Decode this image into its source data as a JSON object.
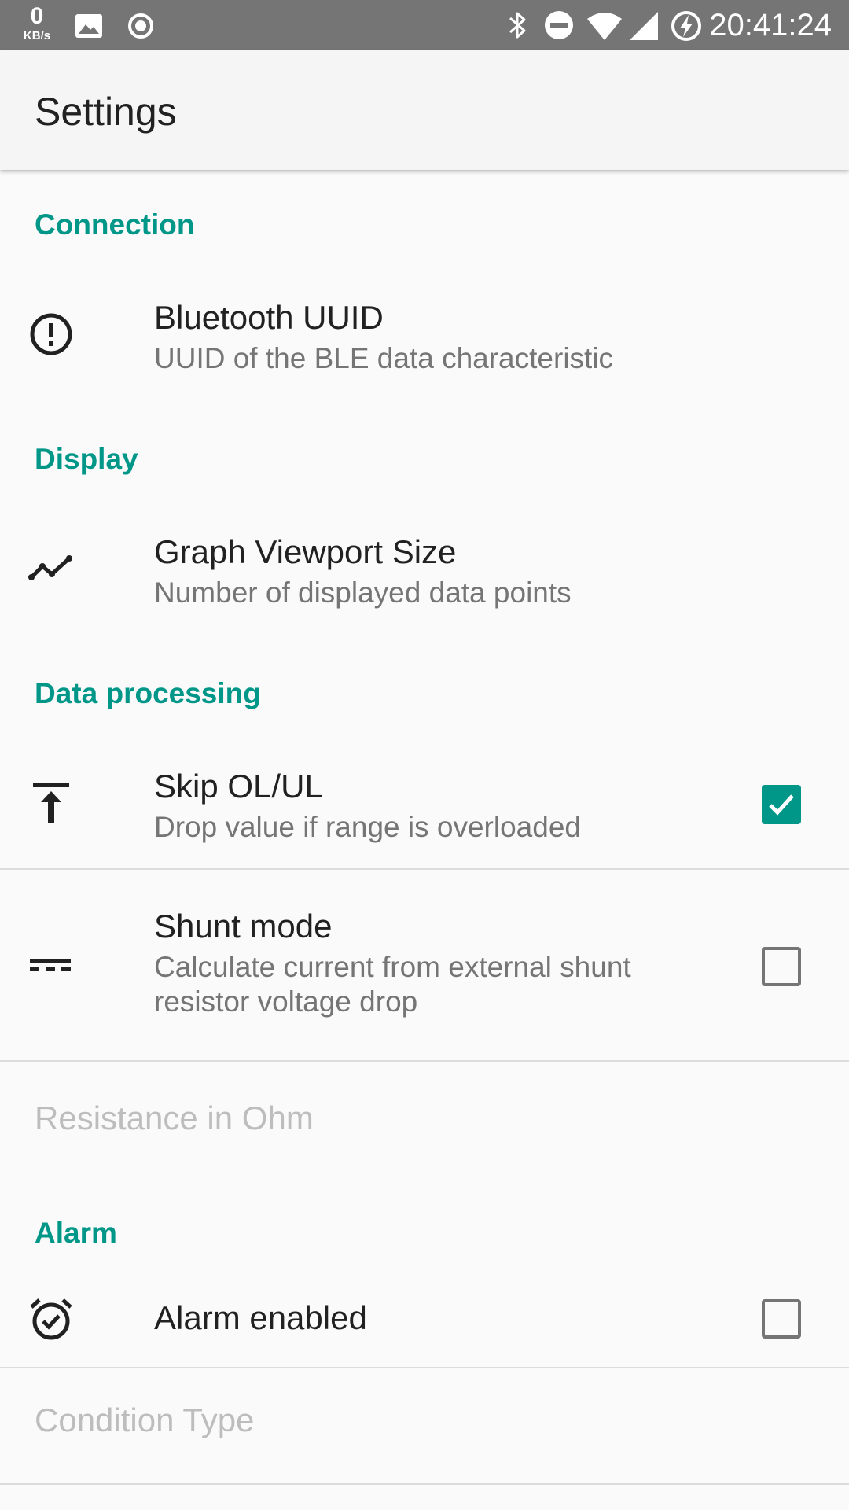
{
  "status_bar": {
    "net_speed_value": "0",
    "net_speed_unit": "KB/s",
    "time": "20:41:24",
    "left_icons": [
      "image-icon",
      "record-icon"
    ],
    "right_icons": [
      "bluetooth-icon",
      "do-not-disturb-icon",
      "wifi-icon",
      "signal-icon",
      "battery-charging-icon"
    ]
  },
  "app_bar": {
    "title": "Settings"
  },
  "sections": {
    "connection": {
      "header": "Connection",
      "bluetooth_uuid": {
        "icon": "alert-circle-icon",
        "title": "Bluetooth UUID",
        "summary": "UUID of the BLE data characteristic"
      }
    },
    "display": {
      "header": "Display",
      "graph_viewport": {
        "icon": "line-chart-icon",
        "title": "Graph Viewport Size",
        "summary": "Number of displayed data points"
      }
    },
    "data_processing": {
      "header": "Data processing",
      "skip_ol_ul": {
        "icon": "vertical-align-top-icon",
        "title": "Skip OL/UL",
        "summary": "Drop value if range is overloaded",
        "checked": true
      },
      "shunt_mode": {
        "icon": "dc-current-icon",
        "title": "Shunt mode",
        "summary_line1": "Calculate current from external shunt",
        "summary_line2": "resistor voltage drop",
        "checked": false
      },
      "resistance": {
        "title": "Resistance in Ohm",
        "enabled": false
      }
    },
    "alarm": {
      "header": "Alarm",
      "alarm_enabled": {
        "icon": "alarm-on-icon",
        "title": "Alarm enabled",
        "checked": false
      },
      "condition_type": {
        "title": "Condition Type",
        "enabled": false
      }
    }
  },
  "colors": {
    "accent": "#009688",
    "status_bar": "#757575",
    "app_bar": "#f5f5f5",
    "background": "#fafafa",
    "primary_text": "#212121",
    "secondary_text": "#757575",
    "disabled_text": "#bdbdbd"
  }
}
